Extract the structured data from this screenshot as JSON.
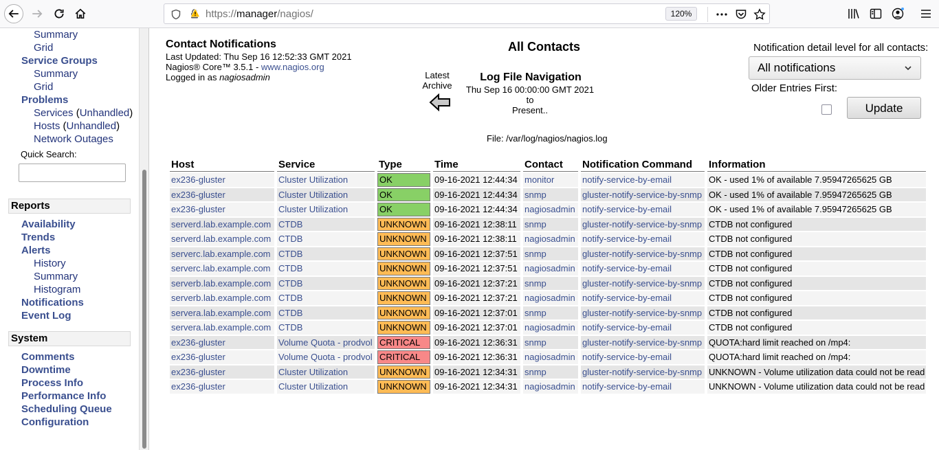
{
  "browser": {
    "url_prefix": "https://",
    "url_host": "manager",
    "url_path": "/nagios/",
    "zoom": "120%"
  },
  "sidebar": {
    "top_items": [
      {
        "label": "Summary",
        "style": "sub"
      },
      {
        "label": "Grid",
        "style": "sub"
      },
      {
        "label": "Service Groups",
        "style": "bold"
      },
      {
        "label": "Summary",
        "style": "sub"
      },
      {
        "label": "Grid",
        "style": "sub"
      },
      {
        "label": "Problems",
        "style": "bold"
      }
    ],
    "services": "Services",
    "hosts": "Hosts",
    "unhandled": "Unhandled",
    "network_outages": "Network Outages",
    "quick_search": "Quick Search:",
    "reports_heading": "Reports",
    "reports_items": [
      "Availability",
      "Trends",
      "Alerts",
      "History",
      "Summary",
      "Histogram",
      "Notifications",
      "Event Log"
    ],
    "system_heading": "System",
    "system_items": [
      "Comments",
      "Downtime",
      "Process Info",
      "Performance Info",
      "Scheduling Queue",
      "Configuration"
    ]
  },
  "header": {
    "title": "Contact Notifications",
    "last_updated": "Last Updated: Thu Sep 16 12:52:33 GMT 2021",
    "version_prefix": "Nagios® Core™ 3.5.1 - ",
    "version_link": "www.nagios.org",
    "logged_in_prefix": "Logged in as ",
    "logged_in_user": "nagiosadmin",
    "center_title": "All Contacts",
    "latest_archive_1": "Latest",
    "latest_archive_2": "Archive",
    "log_nav_title": "Log File Navigation",
    "log_nav_from": "Thu Sep 16 00:00:00 GMT 2021",
    "log_nav_to": "to",
    "log_nav_present": "Present..",
    "file_line": "File: /var/log/nagios/nagios.log",
    "detail_label": "Notification detail level for all contacts:",
    "detail_value": "All notifications",
    "older_label": "Older Entries First:",
    "update_button": "Update"
  },
  "table": {
    "headers": [
      "Host",
      "Service",
      "Type",
      "Time",
      "Contact",
      "Notification Command",
      "Information"
    ],
    "rows": [
      {
        "host": "ex236-gluster",
        "service": "Cluster Utilization",
        "type": "OK",
        "time": "09-16-2021 12:44:34",
        "contact": "monitor",
        "command": "notify-service-by-email",
        "info": "OK - used 1% of available 7.95947265625 GB"
      },
      {
        "host": "ex236-gluster",
        "service": "Cluster Utilization",
        "type": "OK",
        "time": "09-16-2021 12:44:34",
        "contact": "snmp",
        "command": "gluster-notify-service-by-snmp",
        "info": "OK - used 1% of available 7.95947265625 GB"
      },
      {
        "host": "ex236-gluster",
        "service": "Cluster Utilization",
        "type": "OK",
        "time": "09-16-2021 12:44:34",
        "contact": "nagiosadmin",
        "command": "notify-service-by-email",
        "info": "OK - used 1% of available 7.95947265625 GB"
      },
      {
        "host": "serverd.lab.example.com",
        "service": "CTDB",
        "type": "UNKNOWN",
        "time": "09-16-2021 12:38:11",
        "contact": "snmp",
        "command": "gluster-notify-service-by-snmp",
        "info": "CTDB not configured"
      },
      {
        "host": "serverd.lab.example.com",
        "service": "CTDB",
        "type": "UNKNOWN",
        "time": "09-16-2021 12:38:11",
        "contact": "nagiosadmin",
        "command": "notify-service-by-email",
        "info": "CTDB not configured"
      },
      {
        "host": "serverc.lab.example.com",
        "service": "CTDB",
        "type": "UNKNOWN",
        "time": "09-16-2021 12:37:51",
        "contact": "snmp",
        "command": "gluster-notify-service-by-snmp",
        "info": "CTDB not configured"
      },
      {
        "host": "serverc.lab.example.com",
        "service": "CTDB",
        "type": "UNKNOWN",
        "time": "09-16-2021 12:37:51",
        "contact": "nagiosadmin",
        "command": "notify-service-by-email",
        "info": "CTDB not configured"
      },
      {
        "host": "serverb.lab.example.com",
        "service": "CTDB",
        "type": "UNKNOWN",
        "time": "09-16-2021 12:37:21",
        "contact": "snmp",
        "command": "gluster-notify-service-by-snmp",
        "info": "CTDB not configured"
      },
      {
        "host": "serverb.lab.example.com",
        "service": "CTDB",
        "type": "UNKNOWN",
        "time": "09-16-2021 12:37:21",
        "contact": "nagiosadmin",
        "command": "notify-service-by-email",
        "info": "CTDB not configured"
      },
      {
        "host": "servera.lab.example.com",
        "service": "CTDB",
        "type": "UNKNOWN",
        "time": "09-16-2021 12:37:01",
        "contact": "snmp",
        "command": "gluster-notify-service-by-snmp",
        "info": "CTDB not configured"
      },
      {
        "host": "servera.lab.example.com",
        "service": "CTDB",
        "type": "UNKNOWN",
        "time": "09-16-2021 12:37:01",
        "contact": "nagiosadmin",
        "command": "notify-service-by-email",
        "info": "CTDB not configured"
      },
      {
        "host": "ex236-gluster",
        "service": "Volume Quota - prodvol",
        "type": "CRITICAL",
        "time": "09-16-2021 12:36:31",
        "contact": "snmp",
        "command": "gluster-notify-service-by-snmp",
        "info": "QUOTA:hard limit reached on /mp4:"
      },
      {
        "host": "ex236-gluster",
        "service": "Volume Quota - prodvol",
        "type": "CRITICAL",
        "time": "09-16-2021 12:36:31",
        "contact": "nagiosadmin",
        "command": "notify-service-by-email",
        "info": "QUOTA:hard limit reached on /mp4:"
      },
      {
        "host": "ex236-gluster",
        "service": "Cluster Utilization",
        "type": "UNKNOWN",
        "time": "09-16-2021 12:34:31",
        "contact": "snmp",
        "command": "gluster-notify-service-by-snmp",
        "info": "UNKNOWN - Volume utilization data could not be read"
      },
      {
        "host": "ex236-gluster",
        "service": "Cluster Utilization",
        "type": "UNKNOWN",
        "time": "09-16-2021 12:34:31",
        "contact": "nagiosadmin",
        "command": "notify-service-by-email",
        "info": "UNKNOWN - Volume utilization data could not be read"
      }
    ]
  },
  "colors": {
    "ok": "#88d066",
    "unknown": "#ffbb55",
    "critical": "#f88888",
    "link": "#3a4f8f"
  }
}
